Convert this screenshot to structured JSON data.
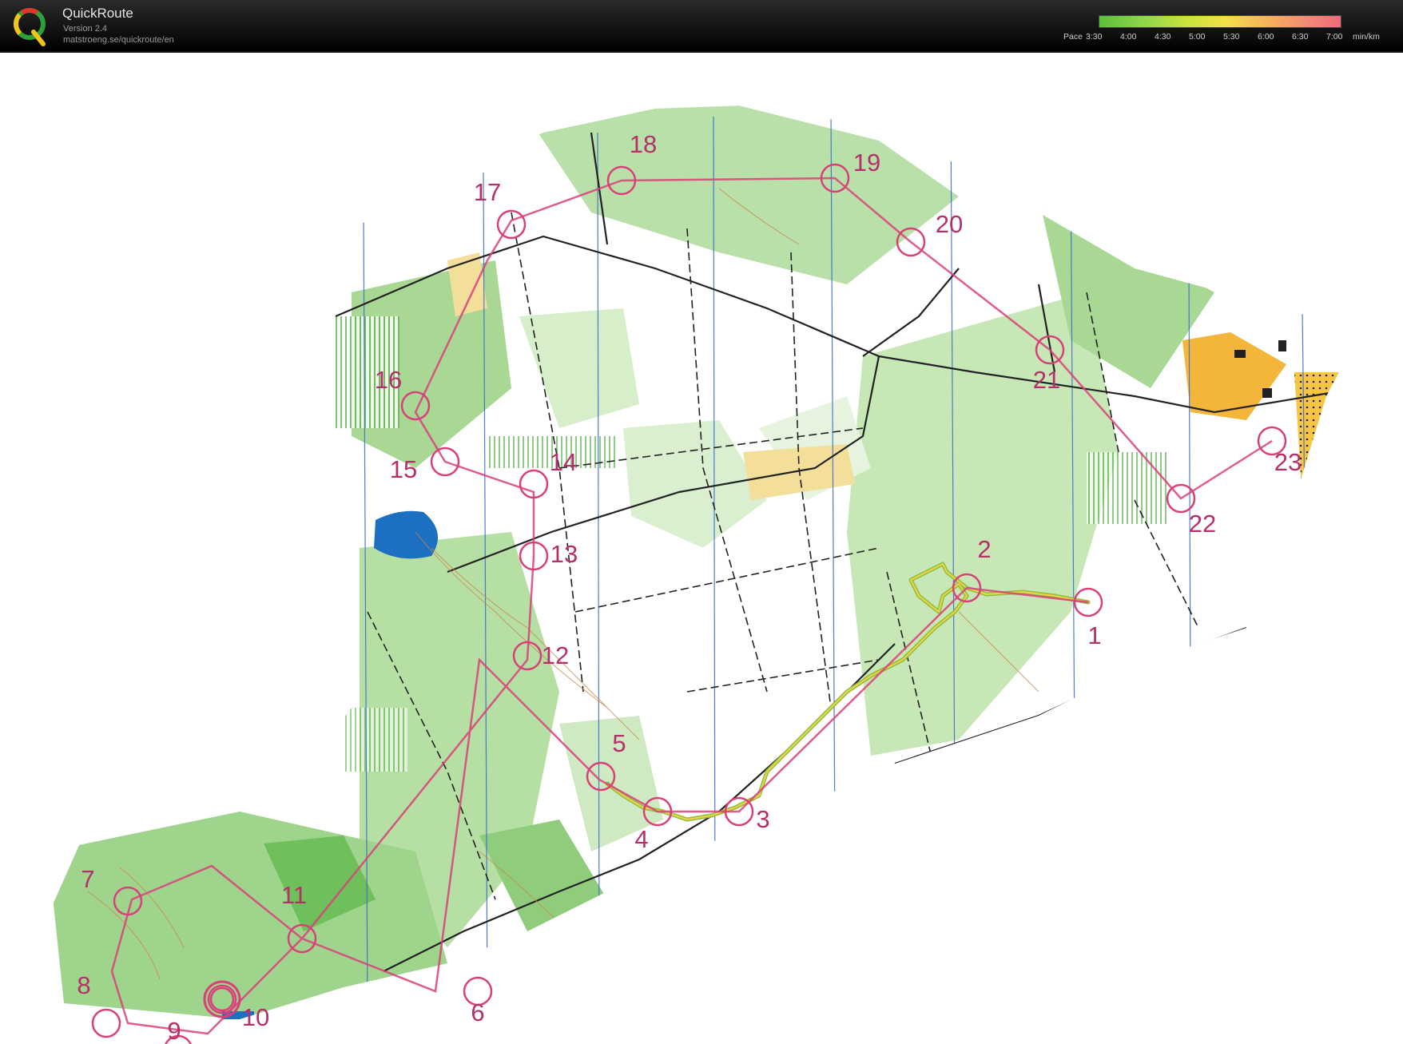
{
  "app": {
    "title": "QuickRoute",
    "version": "Version 2.4",
    "url": "matstroeng.se/quickroute/en",
    "logo_letter": "Q"
  },
  "pace_legend": {
    "label": "Pace",
    "ticks": [
      "3:30",
      "4:00",
      "4:30",
      "5:00",
      "5:30",
      "6:00",
      "6:30",
      "7:00"
    ],
    "unit": "min/km",
    "colors": [
      "#5bbf3a",
      "#8ed64a",
      "#c8e23e",
      "#f2e04a",
      "#f5b25a",
      "#f28a78",
      "#ef6a7a"
    ]
  },
  "map": {
    "course_color": "#d9407a",
    "route_color": "#9dbb3c",
    "controls": [
      {
        "label": "1"
      },
      {
        "label": "2"
      },
      {
        "label": "3"
      },
      {
        "label": "4"
      },
      {
        "label": "5"
      },
      {
        "label": "6"
      },
      {
        "label": "7"
      },
      {
        "label": "8"
      },
      {
        "label": "9"
      },
      {
        "label": "10"
      },
      {
        "label": "11"
      },
      {
        "label": "12"
      },
      {
        "label": "13"
      },
      {
        "label": "14"
      },
      {
        "label": "15"
      },
      {
        "label": "16"
      },
      {
        "label": "17"
      },
      {
        "label": "18"
      },
      {
        "label": "19"
      },
      {
        "label": "20"
      },
      {
        "label": "21"
      },
      {
        "label": "22"
      },
      {
        "label": "23"
      }
    ]
  }
}
